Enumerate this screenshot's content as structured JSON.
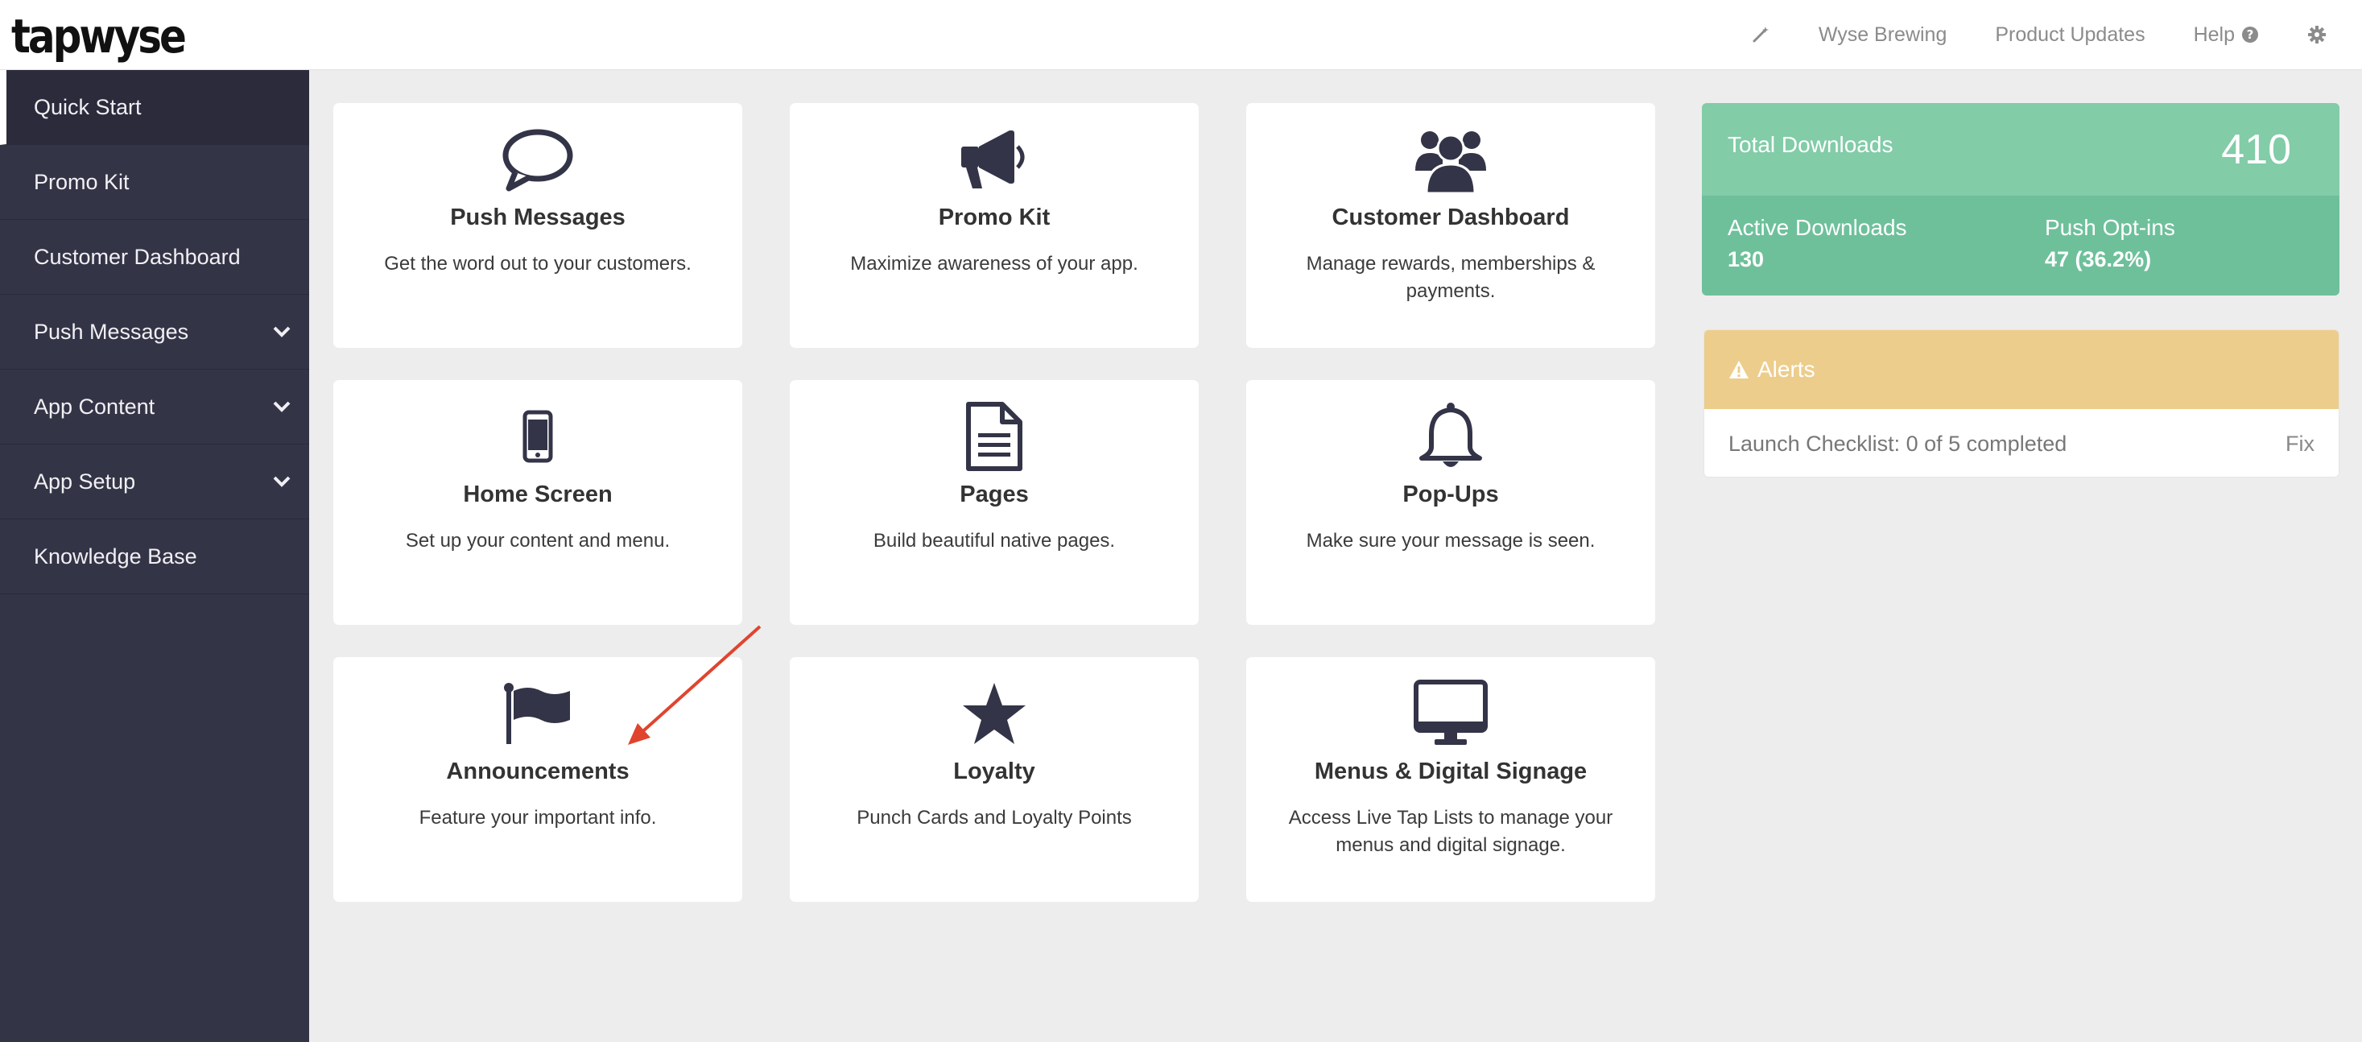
{
  "brand": {
    "logo_text": "tapwyse"
  },
  "topnav": {
    "account": "Wyse Brewing",
    "updates": "Product Updates",
    "help": "Help"
  },
  "sidebar": {
    "items": [
      {
        "label": "Quick Start"
      },
      {
        "label": "Promo Kit"
      },
      {
        "label": "Customer Dashboard"
      },
      {
        "label": "Push Messages"
      },
      {
        "label": "App Content"
      },
      {
        "label": "App Setup"
      },
      {
        "label": "Knowledge Base"
      }
    ]
  },
  "cards": [
    {
      "title": "Push Messages",
      "desc": "Get the word out to your customers.",
      "icon": "speech-bubble-icon"
    },
    {
      "title": "Promo Kit",
      "desc": "Maximize awareness of your app.",
      "icon": "megaphone-icon"
    },
    {
      "title": "Customer Dashboard",
      "desc": "Manage rewards, memberships & payments.",
      "icon": "users-icon"
    },
    {
      "title": "Home Screen",
      "desc": "Set up your content and menu.",
      "icon": "mobile-phone-icon"
    },
    {
      "title": "Pages",
      "desc": "Build beautiful native pages.",
      "icon": "document-icon"
    },
    {
      "title": "Pop-Ups",
      "desc": "Make sure your message is seen.",
      "icon": "bell-icon"
    },
    {
      "title": "Announcements",
      "desc": "Feature your important info.",
      "icon": "flag-icon"
    },
    {
      "title": "Loyalty",
      "desc": "Punch Cards and Loyalty Points",
      "icon": "star-icon"
    },
    {
      "title": "Menus & Digital Signage",
      "desc": "Access Live Tap Lists to manage your menus and digital signage.",
      "icon": "monitor-icon"
    }
  ],
  "stats": {
    "total_label": "Total Downloads",
    "total_value": "410",
    "active_label": "Active Downloads",
    "active_value": "130",
    "optin_label": "Push Opt-ins",
    "optin_value": "47 (36.2%)"
  },
  "alerts": {
    "title": "Alerts",
    "item_text": "Launch Checklist: 0 of 5 completed",
    "item_action": "Fix"
  },
  "colors": {
    "sidebar": "#343447",
    "icon": "#333447",
    "stats_top": "#82cca8",
    "stats_bottom": "#6ec09b",
    "alert_header": "#eccd8c",
    "annotation_arrow": "#e0442f"
  }
}
